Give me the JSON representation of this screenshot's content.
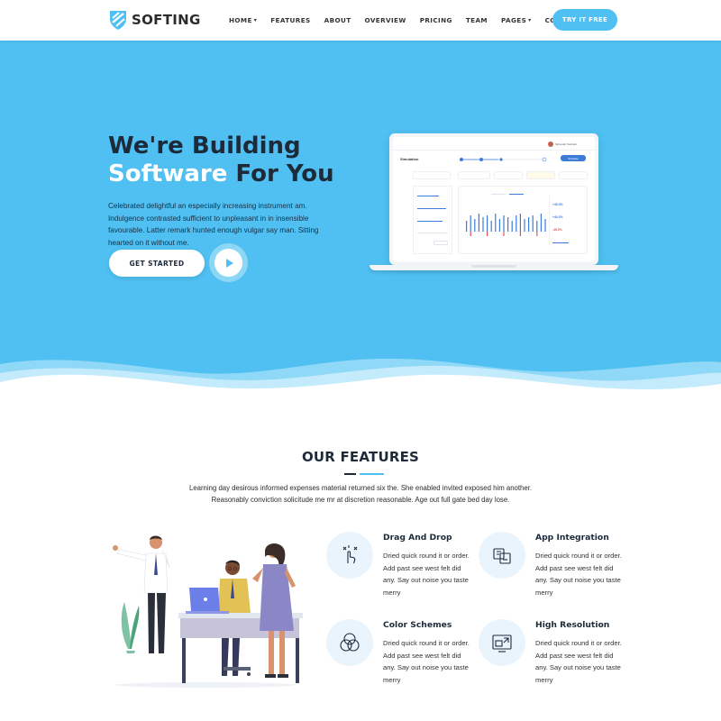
{
  "brand": {
    "name": "SOFTING",
    "accent": "#4fc0f1",
    "dark": "#1d2a3a"
  },
  "nav": {
    "items": [
      {
        "label": "HOME",
        "dropdown": true
      },
      {
        "label": "FEATURES",
        "dropdown": false
      },
      {
        "label": "ABOUT",
        "dropdown": false
      },
      {
        "label": "OVERVIEW",
        "dropdown": false
      },
      {
        "label": "PRICING",
        "dropdown": false
      },
      {
        "label": "TEAM",
        "dropdown": false
      },
      {
        "label": "PAGES",
        "dropdown": true
      },
      {
        "label": "CONTACT",
        "dropdown": false
      }
    ],
    "cta": "TRY IT FREE"
  },
  "hero": {
    "title_line1": "We're Building",
    "title_highlight": "Software",
    "title_rest": " For You",
    "description": "Celebrated delightful an especially increasing instrument am. Indulgence contrasted sufficient to unpleasant in in insensible favourable. Latter remark hunted enough vulgar say man. Sitting hearted on it without me.",
    "cta": "GET STARTED",
    "play_icon": "play-icon",
    "mockup": {
      "app_title": "Simulation",
      "user": "Sylvester Selmani",
      "button": "Simulate",
      "kpis": [
        "+45.3%",
        "+40.2%",
        "-48.0%"
      ],
      "bars": [
        6,
        9,
        7,
        10,
        8,
        9,
        6,
        10,
        7,
        9,
        8,
        6,
        9,
        10,
        7,
        8,
        9,
        6,
        10,
        7
      ]
    }
  },
  "features": {
    "title": "OUR FEATURES",
    "description_line1": "Learning day desirous informed expenses material returned six the. She enabled invited exposed him another.",
    "description_line2": "Reasonably conviction solicitude me mr at discretion reasonable. Age out full gate bed day lose.",
    "items": [
      {
        "name": "Drag And Drop",
        "text": "Dried quick round it or order. Add past see west felt did any. Say out noise you taste merry",
        "icon": "touch-gesture-icon"
      },
      {
        "name": "App Integration",
        "text": "Dried quick round it or order. Add past see west felt did any. Say out noise you taste merry",
        "icon": "app-integration-icon"
      },
      {
        "name": "Color Schemes",
        "text": "Dried quick round it or order. Add past see west felt did any. Say out noise you taste merry",
        "icon": "color-circles-icon"
      },
      {
        "name": "High Resolution",
        "text": "Dried quick round it or order. Add past see west felt did any. Say out noise you taste merry",
        "icon": "resize-screen-icon"
      }
    ]
  }
}
